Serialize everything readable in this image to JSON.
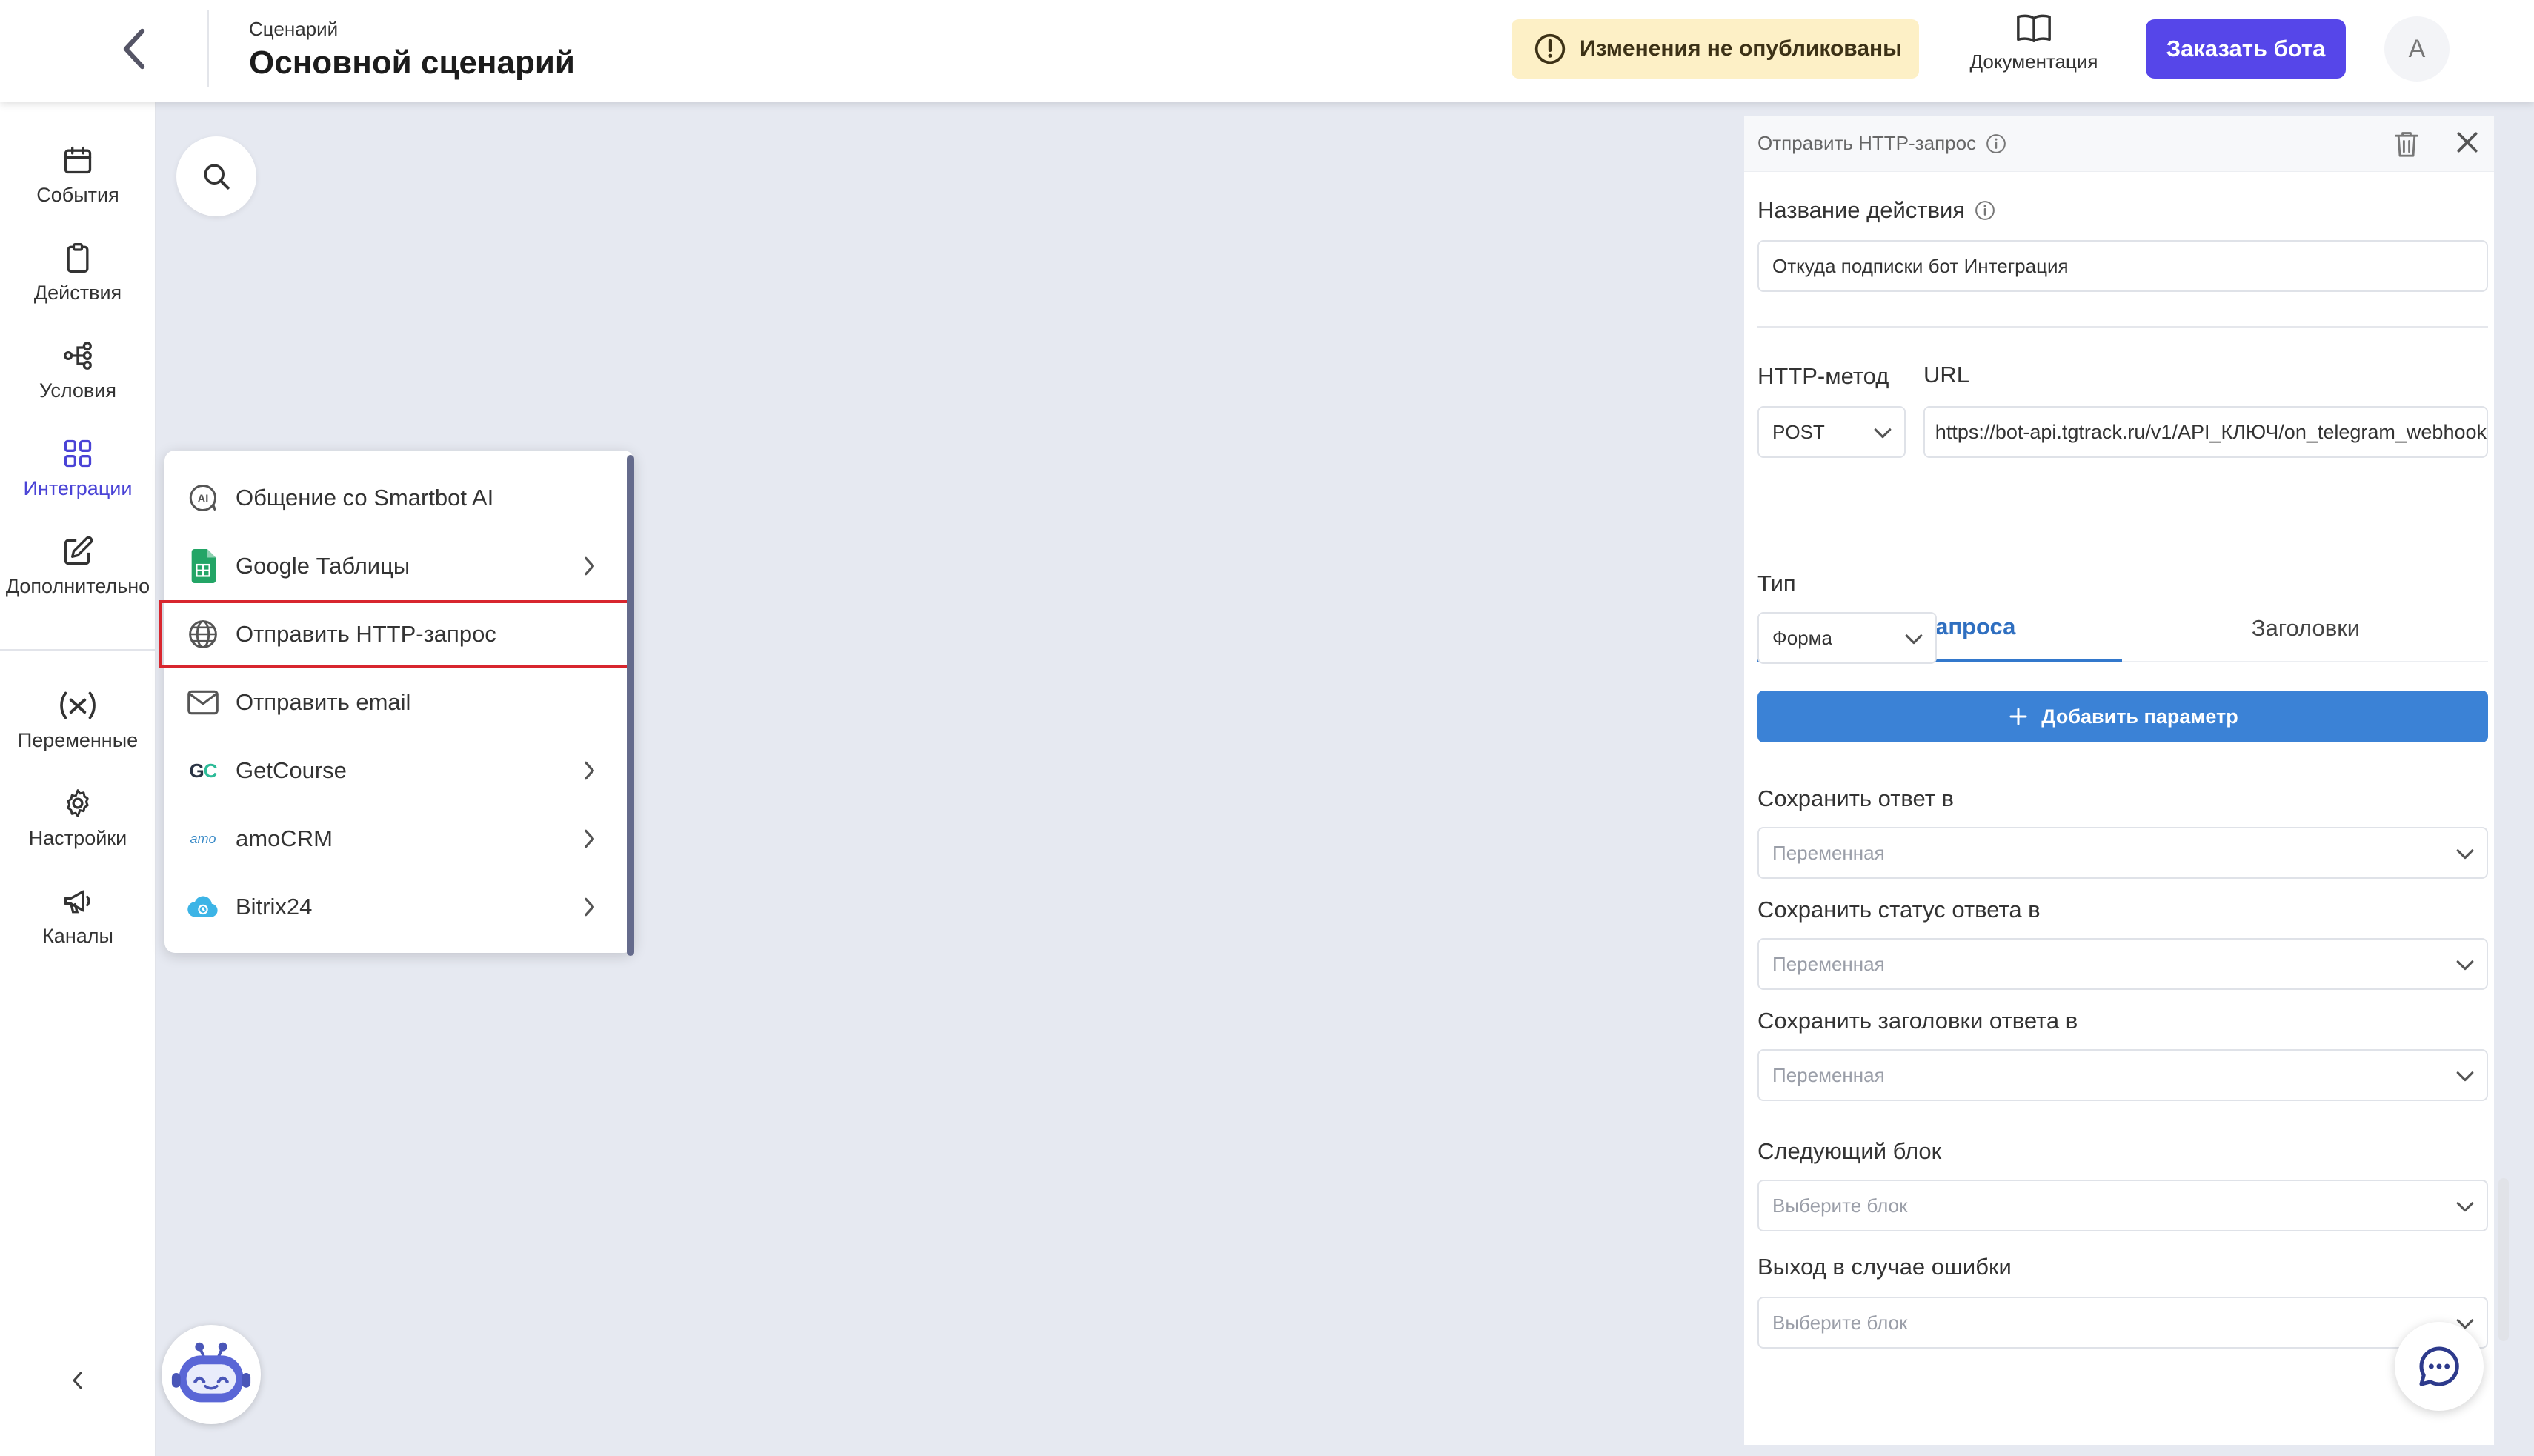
{
  "header": {
    "breadcrumb": "Сценарий",
    "title": "Основной сценарий",
    "warning": "Изменения не опубликованы",
    "docs_label": "Документация",
    "order_label": "Заказать бота",
    "avatar_letter": "А"
  },
  "nav": {
    "items": [
      {
        "label": "События",
        "icon": "calendar-icon"
      },
      {
        "label": "Действия",
        "icon": "clipboard-icon"
      },
      {
        "label": "Условия",
        "icon": "branch-icon"
      },
      {
        "label": "Интеграции",
        "icon": "grid-icon",
        "active": true
      },
      {
        "label": "Дополнительно",
        "icon": "edit-icon"
      },
      {
        "label": "Переменные",
        "icon": "variable-icon"
      },
      {
        "label": "Настройки",
        "icon": "gear-icon"
      },
      {
        "label": "Каналы",
        "icon": "megaphone-icon"
      }
    ]
  },
  "menu": {
    "items": [
      {
        "label": "Общение со Smartbot AI",
        "icon": "ai-icon",
        "has_sub": false
      },
      {
        "label": "Google Таблицы",
        "icon": "sheets-icon",
        "has_sub": true
      },
      {
        "label": "Отправить HTTP-запрос",
        "icon": "globe-icon",
        "has_sub": false,
        "highlighted": true
      },
      {
        "label": "Отправить email",
        "icon": "mail-icon",
        "has_sub": false
      },
      {
        "label": "GetCourse",
        "icon": "getcourse-icon",
        "icon_text": "GC",
        "has_sub": true
      },
      {
        "label": "amoCRM",
        "icon": "amocrm-icon",
        "icon_text": "amo",
        "has_sub": true
      },
      {
        "label": "Bitrix24",
        "icon": "bitrix-cloud-icon",
        "has_sub": true
      }
    ]
  },
  "panel": {
    "header_title": "Отправить HTTP-запрос",
    "action_name_label": "Название действия",
    "action_name_value": "Откуда подписки бот Интеграция",
    "method_label": "HTTP-метод",
    "method_value": "POST",
    "url_label": "URL",
    "url_value": "https://bot-api.tgtrack.ru/v1/API_КЛЮЧ/on_telegram_webhook",
    "tabs": [
      "Тело запроса",
      "Заголовки"
    ],
    "type_label": "Тип",
    "type_value": "Форма",
    "add_param": "Добавить параметр",
    "save_response_label": "Сохранить ответ в",
    "save_status_label": "Сохранить статус ответа в",
    "save_headers_label": "Сохранить заголовки ответа в",
    "variable_placeholder": "Переменная",
    "next_block_label": "Следующий блок",
    "error_exit_label": "Выход в случае ошибки",
    "block_placeholder": "Выберите блок"
  },
  "colors": {
    "accent": "#5646e9",
    "primary_blue": "#3b82d6",
    "warning_bg": "#fdf0c6",
    "highlight_border": "#d8262e"
  }
}
